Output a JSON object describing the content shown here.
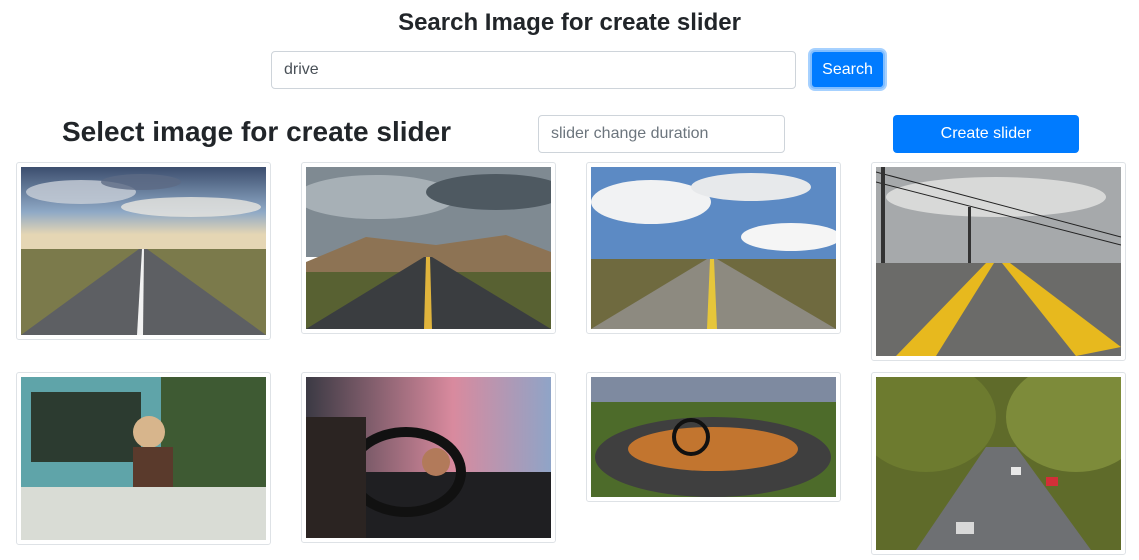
{
  "header": {
    "title": "Search Image for create slider"
  },
  "search": {
    "value": "drive",
    "button_label": "Search"
  },
  "slider": {
    "heading": "Select image for create slider",
    "duration_placeholder": "slider change duration",
    "create_label": "Create slider"
  },
  "images": [
    {
      "subject": "straight road under cloudy sky"
    },
    {
      "subject": "road toward misty mountains"
    },
    {
      "subject": "road with yellow line and clouds"
    },
    {
      "subject": "close-up road yellow lines and power poles"
    },
    {
      "subject": "woman in vintage pickup truck"
    },
    {
      "subject": "driver hands on steering wheel"
    },
    {
      "subject": "convertible classic car interior"
    },
    {
      "subject": "tree-lined city avenue with traffic"
    }
  ]
}
